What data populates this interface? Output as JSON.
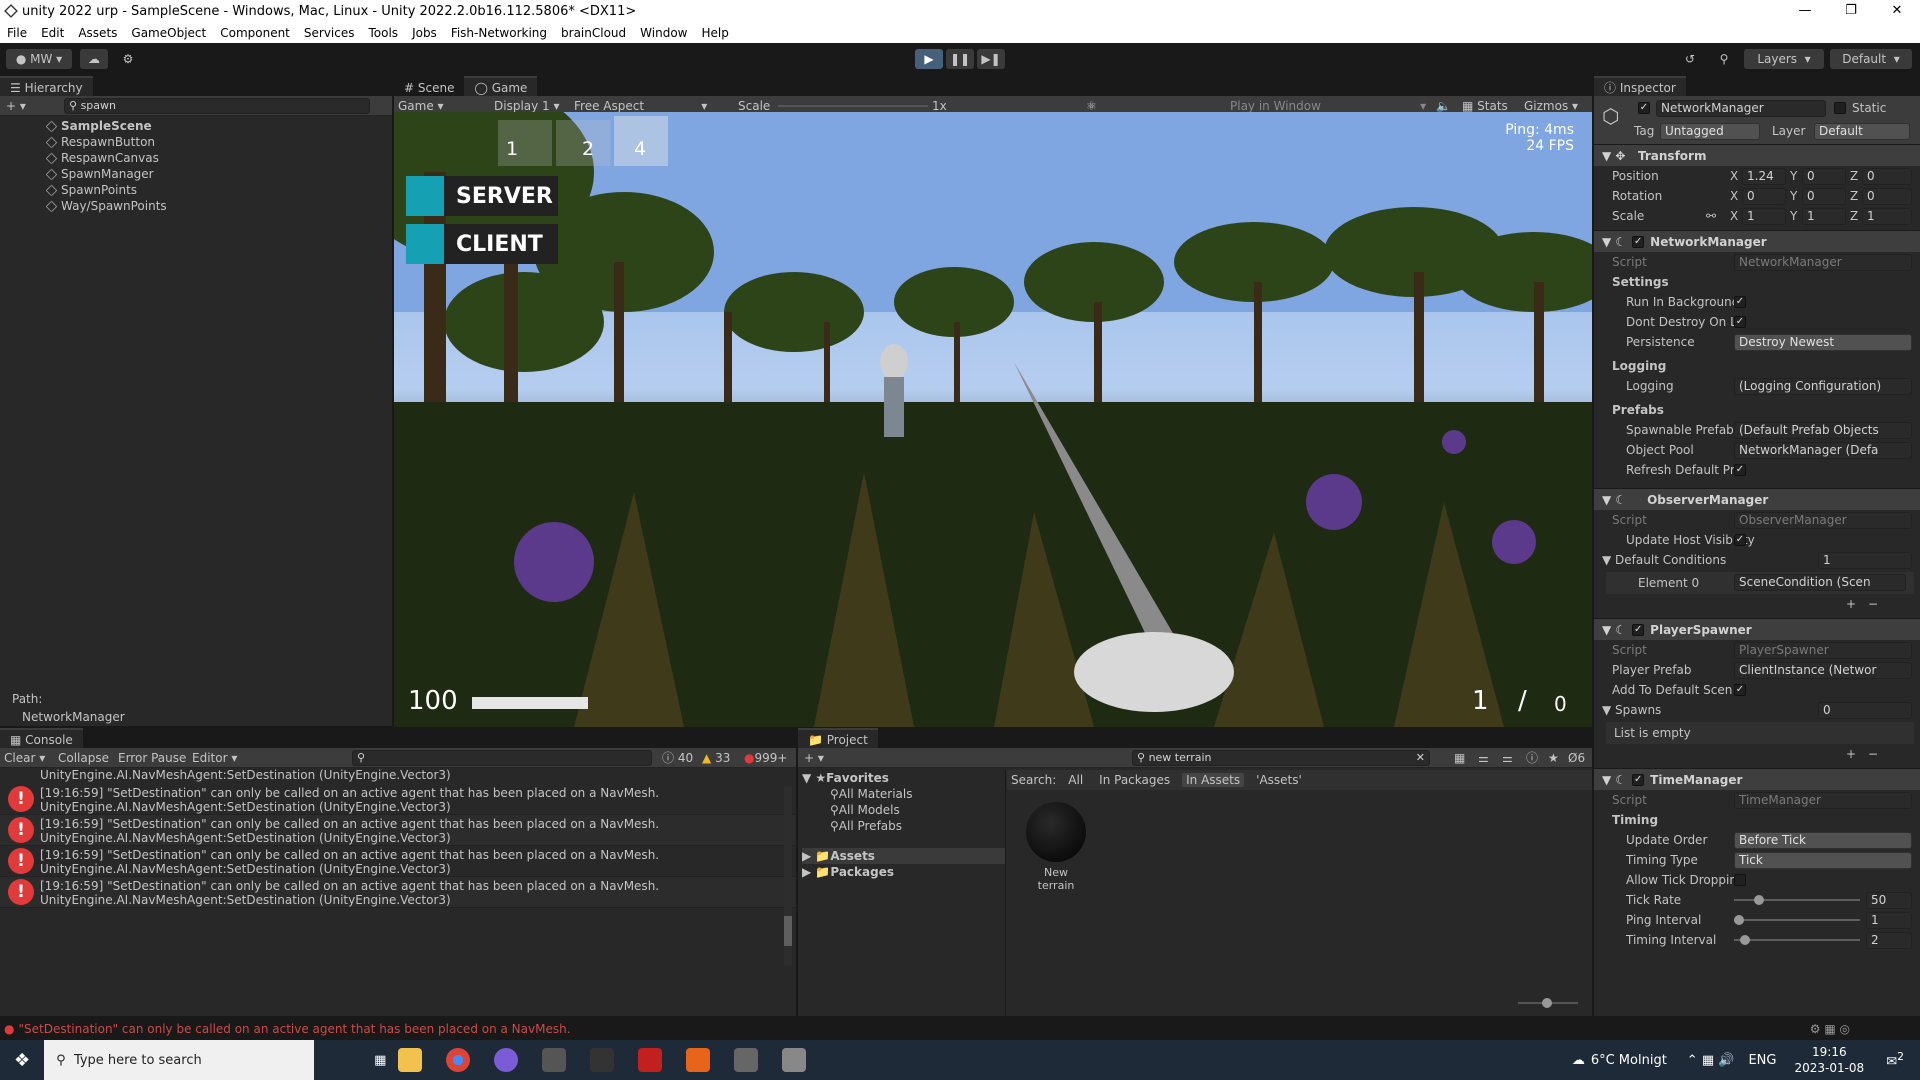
{
  "window": {
    "title": "unity 2022 urp - SampleScene - Windows, Mac, Linux - Unity 2022.2.0b16.112.5806* <DX11>"
  },
  "menu": [
    "File",
    "Edit",
    "Assets",
    "GameObject",
    "Component",
    "Services",
    "Tools",
    "Jobs",
    "Fish-Networking",
    "brainCloud",
    "Window",
    "Help"
  ],
  "toolbar": {
    "account": "MW",
    "layers": "Layers",
    "layout": "Default"
  },
  "hierarchy": {
    "tab": "Hierarchy",
    "search": "spawn",
    "scene": "SampleScene",
    "items": [
      "RespawnButton",
      "RespawnCanvas",
      "SpawnManager",
      "SpawnPoints",
      "Way/SpawnPoints"
    ],
    "path_label": "Path:",
    "path_value": "NetworkManager"
  },
  "sceneview": {
    "tabs": [
      "Scene",
      "Game"
    ],
    "game_dropdown": "Game",
    "display": "Display 1",
    "aspect": "Free Aspect",
    "scale_label": "Scale",
    "scale_value": "1x",
    "play_mode": "Play in Window",
    "stats": "Stats",
    "gizmos": "Gizmos"
  },
  "game": {
    "slots": [
      "1",
      "2",
      "4"
    ],
    "server_button": "SERVER",
    "client_button": "CLIENT",
    "ping": "Ping: 4ms",
    "fps": "24 FPS",
    "health": "100",
    "health_fraction": 1.0,
    "ammo_current": "1",
    "ammo_sep": "/",
    "ammo_reserve": "0"
  },
  "inspector": {
    "tab": "Inspector",
    "object_name": "NetworkManager",
    "static": "Static",
    "tag_label": "Tag",
    "tag": "Untagged",
    "layer_label": "Layer",
    "layer": "Default",
    "transform": {
      "title": "Transform",
      "position": {
        "label": "Position",
        "x": "1.24",
        "y": "0",
        "z": "0"
      },
      "rotation": {
        "label": "Rotation",
        "x": "0",
        "y": "0",
        "z": "0"
      },
      "scale": {
        "label": "Scale",
        "x": "1",
        "y": "1",
        "z": "1"
      }
    },
    "network_manager": {
      "title": "NetworkManager",
      "script_label": "Script",
      "script": "NetworkManager",
      "settings": "Settings",
      "run_bg": "Run In Backgrounc",
      "dont_destroy": "Dont Destroy On L",
      "persistence_label": "Persistence",
      "persistence": "Destroy Newest",
      "logging_section": "Logging",
      "logging_label": "Logging",
      "logging": "(Logging Configuration)",
      "prefabs_section": "Prefabs",
      "spawnable_label": "Spawnable Prefab",
      "spawnable": "(Default Prefab Objects",
      "pool_label": "Object Pool",
      "pool": "NetworkManager (Defa",
      "refresh_label": "Refresh Default Pr"
    },
    "observer_manager": {
      "title": "ObserverManager",
      "script_label": "Script",
      "script": "ObserverManager",
      "update_host": "Update Host Visibility",
      "default_conditions": "Default Conditions",
      "count": "1",
      "element_label": "Element 0",
      "element": "SceneCondition (Scen"
    },
    "player_spawner": {
      "title": "PlayerSpawner",
      "script_label": "Script",
      "script": "PlayerSpawner",
      "prefab_label": "Player Prefab",
      "prefab": "ClientInstance (Networ",
      "add_default": "Add To Default Scen",
      "spawns_label": "Spawns",
      "spawns_count": "0",
      "list_empty": "List is empty"
    },
    "time_manager": {
      "title": "TimeManager",
      "script_label": "Script",
      "script": "TimeManager",
      "timing": "Timing",
      "update_order_label": "Update Order",
      "update_order": "Before Tick",
      "timing_type_label": "Timing Type",
      "timing_type": "Tick",
      "allow_drop": "Allow Tick Droppin",
      "tick_rate_label": "Tick Rate",
      "tick_rate": "50",
      "ping_interval_label": "Ping Interval",
      "ping_interval": "1",
      "timing_interval_label": "Timing Interval",
      "timing_interval": "2"
    }
  },
  "console": {
    "tab": "Console",
    "clear": "Clear",
    "collapse": "Collapse",
    "error_pause": "Error Pause",
    "editor": "Editor",
    "count_info": "40",
    "count_warn": "33",
    "count_err": "999+",
    "top_line": "UnityEngine.AI.NavMeshAgent:SetDestination (UnityEngine.Vector3)",
    "entries": [
      {
        "line1": "[19:16:59] \"SetDestination\" can only be called on an active agent that has been placed on a NavMesh.",
        "line2": "UnityEngine.AI.NavMeshAgent:SetDestination (UnityEngine.Vector3)"
      },
      {
        "line1": "[19:16:59] \"SetDestination\" can only be called on an active agent that has been placed on a NavMesh.",
        "line2": "UnityEngine.AI.NavMeshAgent:SetDestination (UnityEngine.Vector3)"
      },
      {
        "line1": "[19:16:59] \"SetDestination\" can only be called on an active agent that has been placed on a NavMesh.",
        "line2": "UnityEngine.AI.NavMeshAgent:SetDestination (UnityEngine.Vector3)"
      },
      {
        "line1": "[19:16:59] \"SetDestination\" can only be called on an active agent that has been placed on a NavMesh.",
        "line2": "UnityEngine.AI.NavMeshAgent:SetDestination (UnityEngine.Vector3)"
      }
    ]
  },
  "project": {
    "tab": "Project",
    "search": "new terrain",
    "favorites": "Favorites",
    "fav_items": [
      "All Materials",
      "All Models",
      "All Prefabs"
    ],
    "folders": [
      "Assets",
      "Packages"
    ],
    "search_label": "Search:",
    "search_scopes": [
      "All",
      "In Packages",
      "In Assets",
      "'Assets'"
    ],
    "asset_name": "New terrain",
    "hidden_count": "6"
  },
  "statusbar": {
    "message": "\"SetDestination\" can only be called on an active agent that has been placed on a NavMesh."
  },
  "taskbar": {
    "search_placeholder": "Type here to search",
    "weather": "6°C  Molnigt",
    "lang": "ENG",
    "time": "19:16",
    "date": "2023-01-08",
    "notif": "2"
  }
}
